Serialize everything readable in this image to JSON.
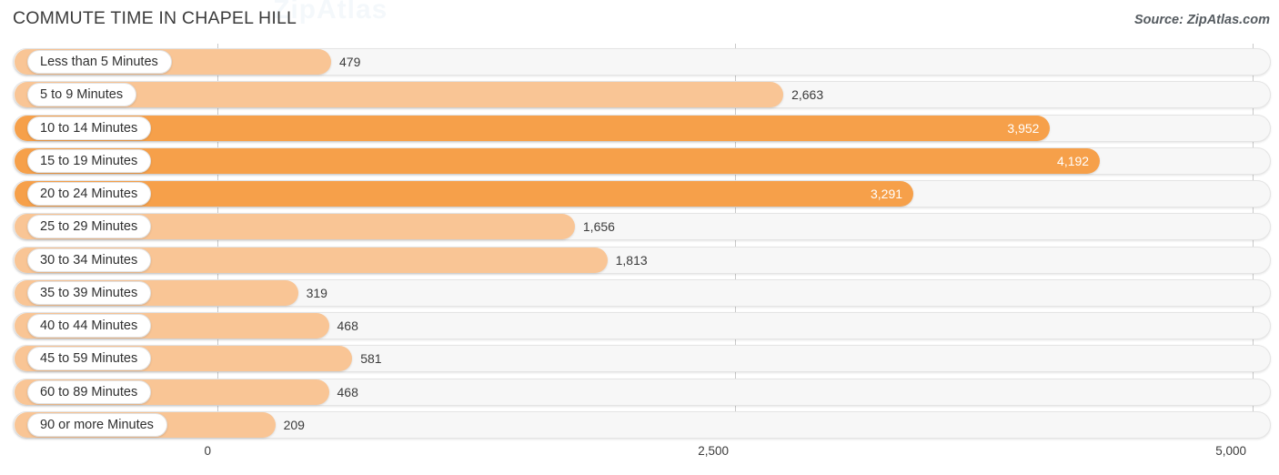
{
  "header": {
    "title": "COMMUTE TIME IN CHAPEL HILL",
    "source": "Source: ZipAtlas.com",
    "watermark": "ZipAtlas"
  },
  "colors": {
    "bar_light": "#f9c595",
    "bar_dark": "#f6a04a",
    "track": "#f7f7f7",
    "grid": "#c8c8c8",
    "text": "#3b3b3b"
  },
  "chart_data": {
    "type": "bar",
    "orientation": "horizontal",
    "title": "COMMUTE TIME IN CHAPEL HILL",
    "xlabel": "",
    "ylabel": "",
    "xlim": [
      0,
      5000
    ],
    "grid": true,
    "legend": "none",
    "xticks": [
      "0",
      "2,500",
      "5,000"
    ],
    "xtick_values": [
      0,
      2500,
      5000
    ],
    "categories": [
      "Less than 5 Minutes",
      "5 to 9 Minutes",
      "10 to 14 Minutes",
      "15 to 19 Minutes",
      "20 to 24 Minutes",
      "25 to 29 Minutes",
      "30 to 34 Minutes",
      "35 to 39 Minutes",
      "40 to 44 Minutes",
      "45 to 59 Minutes",
      "60 to 89 Minutes",
      "90 or more Minutes"
    ],
    "values": [
      479,
      2663,
      3952,
      4192,
      3291,
      1656,
      1813,
      319,
      468,
      581,
      468,
      209
    ],
    "value_labels": [
      "479",
      "2,663",
      "3,952",
      "4,192",
      "3,291",
      "1,656",
      "1,813",
      "319",
      "468",
      "581",
      "468",
      "209"
    ]
  },
  "rows": [
    {
      "label": "Less than 5 Minutes",
      "value": 479,
      "value_label": "479",
      "inside": false,
      "dark": false
    },
    {
      "label": "5 to 9 Minutes",
      "value": 2663,
      "value_label": "2,663",
      "inside": false,
      "dark": false
    },
    {
      "label": "10 to 14 Minutes",
      "value": 3952,
      "value_label": "3,952",
      "inside": true,
      "dark": true
    },
    {
      "label": "15 to 19 Minutes",
      "value": 4192,
      "value_label": "4,192",
      "inside": true,
      "dark": true
    },
    {
      "label": "20 to 24 Minutes",
      "value": 3291,
      "value_label": "3,291",
      "inside": true,
      "dark": true
    },
    {
      "label": "25 to 29 Minutes",
      "value": 1656,
      "value_label": "1,656",
      "inside": false,
      "dark": false
    },
    {
      "label": "30 to 34 Minutes",
      "value": 1813,
      "value_label": "1,813",
      "inside": false,
      "dark": false
    },
    {
      "label": "35 to 39 Minutes",
      "value": 319,
      "value_label": "319",
      "inside": false,
      "dark": false
    },
    {
      "label": "40 to 44 Minutes",
      "value": 468,
      "value_label": "468",
      "inside": false,
      "dark": false
    },
    {
      "label": "45 to 59 Minutes",
      "value": 581,
      "value_label": "581",
      "inside": false,
      "dark": false
    },
    {
      "label": "60 to 89 Minutes",
      "value": 468,
      "value_label": "468",
      "inside": false,
      "dark": false
    },
    {
      "label": "90 or more Minutes",
      "value": 209,
      "value_label": "209",
      "inside": false,
      "dark": false
    }
  ]
}
